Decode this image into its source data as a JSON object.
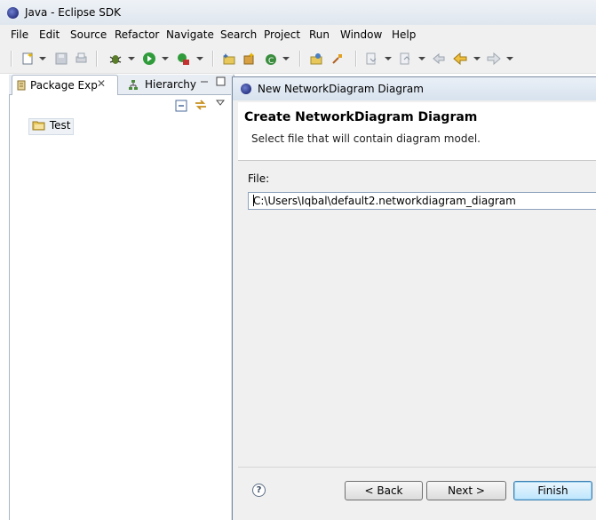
{
  "window": {
    "title": "Java - Eclipse SDK"
  },
  "menu": [
    "File",
    "Edit",
    "Source",
    "Refactor",
    "Navigate",
    "Search",
    "Project",
    "Run",
    "Window",
    "Help"
  ],
  "views": {
    "package_explorer_tab": "Package Exp",
    "hierarchy_tab": "Hierarchy",
    "tree": [
      {
        "label": "Test"
      }
    ]
  },
  "dialog": {
    "title": "New NetworkDiagram Diagram",
    "heading": "Create NetworkDiagram Diagram",
    "description": "Select file that will contain diagram model.",
    "file_label": "File:",
    "file_value": "C:\\Users\\Iqbal\\default2.networkdiagram_diagram",
    "help_label": "?",
    "buttons": {
      "back": "< Back",
      "next": "Next >",
      "finish": "Finish"
    }
  }
}
